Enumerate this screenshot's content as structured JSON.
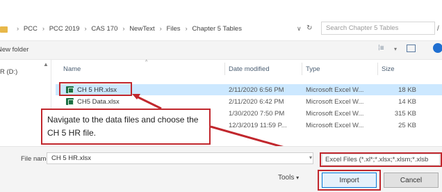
{
  "address_bar": {
    "breadcrumb": [
      "PCC",
      "PCC 2019",
      "CAS 170",
      "NewText",
      "Files",
      "Chapter 5 Tables"
    ],
    "search_placeholder": "Search Chapter 5 Tables"
  },
  "toolbar": {
    "new_folder_label": "New folder"
  },
  "nav": {
    "drive_label": "R (D:)"
  },
  "columns": {
    "name": "Name",
    "date_modified": "Date modified",
    "type": "Type",
    "size": "Size"
  },
  "files": [
    {
      "name": "CH 5 HR.xlsx",
      "date": "2/11/2020 6:56 PM",
      "type": "Microsoft Excel W...",
      "size": "18 KB",
      "selected": true
    },
    {
      "name": "CH5 Data.xlsx",
      "date": "2/11/2020 6:42 PM",
      "type": "Microsoft Excel W...",
      "size": "14 KB",
      "selected": false
    },
    {
      "name": "",
      "date": "1/30/2020 7:50 PM",
      "type": "Microsoft Excel W...",
      "size": "315 KB",
      "selected": false
    },
    {
      "name": "",
      "date": "12/3/2019 11:59 P...",
      "type": "Microsoft Excel W...",
      "size": "25 KB",
      "selected": false
    }
  ],
  "callout": {
    "text": "Navigate to the data files and choose the CH 5 HR file."
  },
  "bottom": {
    "file_name_label": "File name:",
    "file_name_value": "CH 5 HR.xlsx",
    "file_type_filter": "Excel Files (*.xl*;*.xlsx;*.xlsm;*.xlsb",
    "tools_label": "Tools",
    "import_label": "Import",
    "cancel_label": "Cancel"
  },
  "colors": {
    "highlight": "#c1272d",
    "selection": "#cce8ff",
    "excel": "#1d7044",
    "accent": "#0078d7"
  }
}
